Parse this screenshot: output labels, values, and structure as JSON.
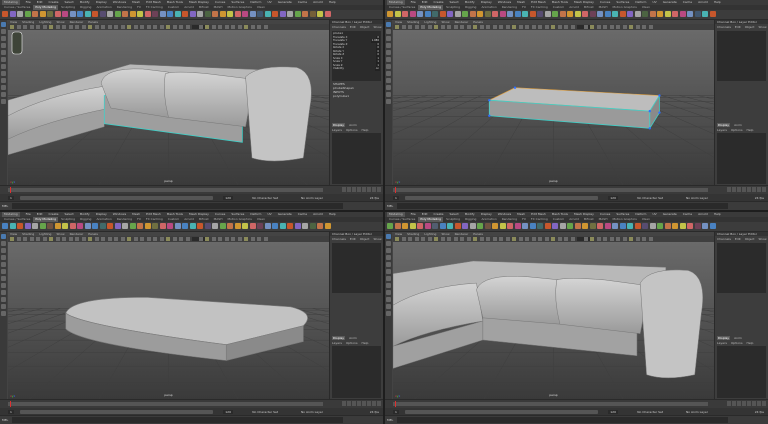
{
  "app": {
    "menus": [
      "File",
      "Edit",
      "Create",
      "Select",
      "Modify",
      "Display",
      "Windows",
      "Mesh",
      "Edit Mesh",
      "Mesh Tools",
      "Mesh Display",
      "Curves",
      "Surfaces",
      "Deform",
      "UV",
      "Generate",
      "Cache",
      "Arnold",
      "Help"
    ],
    "mode": "Modeling",
    "shelf_tabs": [
      "Curves / Surfaces",
      "Poly Modeling",
      "Sculpting",
      "Rigging",
      "Animation",
      "Rendering",
      "FX",
      "FX Caching",
      "Custom",
      "Arnold",
      "Bifrost",
      "MASH",
      "Motion Graphics",
      "XGen"
    ],
    "active_shelf": "Poly Modeling",
    "viewport_menu": [
      "View",
      "Shading",
      "Lighting",
      "Show",
      "Renderer",
      "Panels"
    ],
    "channel_title": "Channel Box / Layer Editor",
    "channel_tabs": [
      "Channels",
      "Edit",
      "Object",
      "Show"
    ],
    "layer_tabs": [
      "Display",
      "Anim"
    ],
    "layer_menu": [
      "Layers",
      "Options",
      "Help"
    ],
    "cmd_label": "MEL",
    "colors": {
      "selection": "#3fd0c8",
      "pivot": "#2f6fff",
      "timeline_marker": "#e03030"
    }
  },
  "panes": [
    {
      "id": "p0",
      "camera": "persp",
      "channel_object": "pCube1",
      "channels": [
        {
          "name": "Translate X",
          "value": "0"
        },
        {
          "name": "Translate Y",
          "value": "1.086"
        },
        {
          "name": "Translate Z",
          "value": "0"
        },
        {
          "name": "Rotate X",
          "value": "0"
        },
        {
          "name": "Rotate Y",
          "value": "0"
        },
        {
          "name": "Rotate Z",
          "value": "0"
        },
        {
          "name": "Scale X",
          "value": "1"
        },
        {
          "name": "Scale Y",
          "value": "1"
        },
        {
          "name": "Scale Z",
          "value": "1"
        },
        {
          "name": "Visibility",
          "value": "on"
        }
      ],
      "shapes_label": "SHAPES",
      "shape_name": "pCubeShape1",
      "inputs_label": "INPUTS",
      "input_name": "polyCube1",
      "range_start": "1",
      "range_end": "120",
      "character_set": "No Character Set",
      "anim_layer": "No Anim Layer",
      "fps": "24 fps"
    },
    {
      "id": "p1",
      "camera": "persp",
      "range_start": "1",
      "range_end": "120",
      "character_set": "No Character Set",
      "anim_layer": "No Anim Layer",
      "fps": "24 fps"
    },
    {
      "id": "p2",
      "camera": "persp",
      "range_start": "1",
      "range_end": "120",
      "character_set": "No Character Set",
      "anim_layer": "No Anim Layer",
      "fps": "24 fps"
    },
    {
      "id": "p3",
      "camera": "persp",
      "range_start": "1",
      "range_end": "120",
      "character_set": "No Character Set",
      "anim_layer": "No Anim Layer",
      "fps": "24 fps"
    }
  ]
}
